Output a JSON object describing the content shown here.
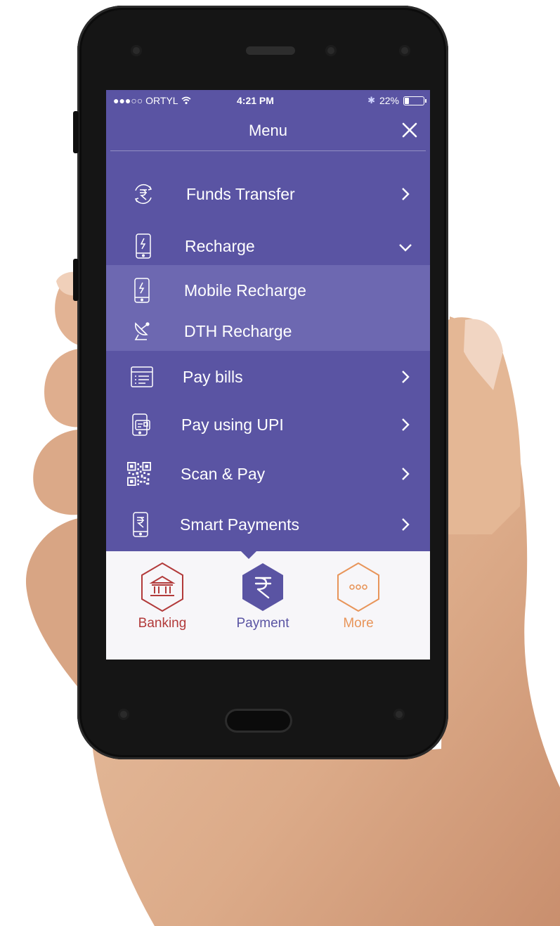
{
  "status_bar": {
    "carrier": "●●●○○ ORTYL",
    "time": "4:21 PM",
    "battery": "22%",
    "battery_level": 0.22
  },
  "header": {
    "title": "Menu",
    "close_icon": "close-icon"
  },
  "menu": {
    "items": [
      {
        "label": "Funds Transfer",
        "icon": "rupee-cycle-icon",
        "chevron": "chevron-right-icon"
      },
      {
        "label": "Recharge",
        "icon": "phone-bolt-icon",
        "chevron": "chevron-down-icon"
      },
      {
        "label": "Pay bills",
        "icon": "bill-icon",
        "chevron": "chevron-right-icon"
      },
      {
        "label": "Pay using UPI",
        "icon": "upi-phone-icon",
        "chevron": "chevron-right-icon"
      },
      {
        "label": "Scan & Pay",
        "icon": "qr-code-icon",
        "chevron": "chevron-right-icon"
      },
      {
        "label": "Smart Payments",
        "icon": "phone-rupee-icon",
        "chevron": "chevron-right-icon"
      }
    ],
    "recharge_submenu": [
      {
        "label": "Mobile Recharge",
        "icon": "phone-bolt-icon"
      },
      {
        "label": "DTH Recharge",
        "icon": "satellite-dish-icon"
      }
    ]
  },
  "bottom_nav": {
    "tabs": [
      {
        "label": "Banking",
        "icon": "bank-icon",
        "color": "#b23a3a"
      },
      {
        "label": "Payment",
        "icon": "rupee-icon",
        "color": "#5a54a3",
        "active": true
      },
      {
        "label": "More",
        "icon": "more-dots-icon",
        "color": "#e8955a"
      }
    ]
  },
  "colors": {
    "menu_background": "#5a54a3",
    "submenu_background": "#6d68b1",
    "bottom_background": "#f7f6f9"
  }
}
